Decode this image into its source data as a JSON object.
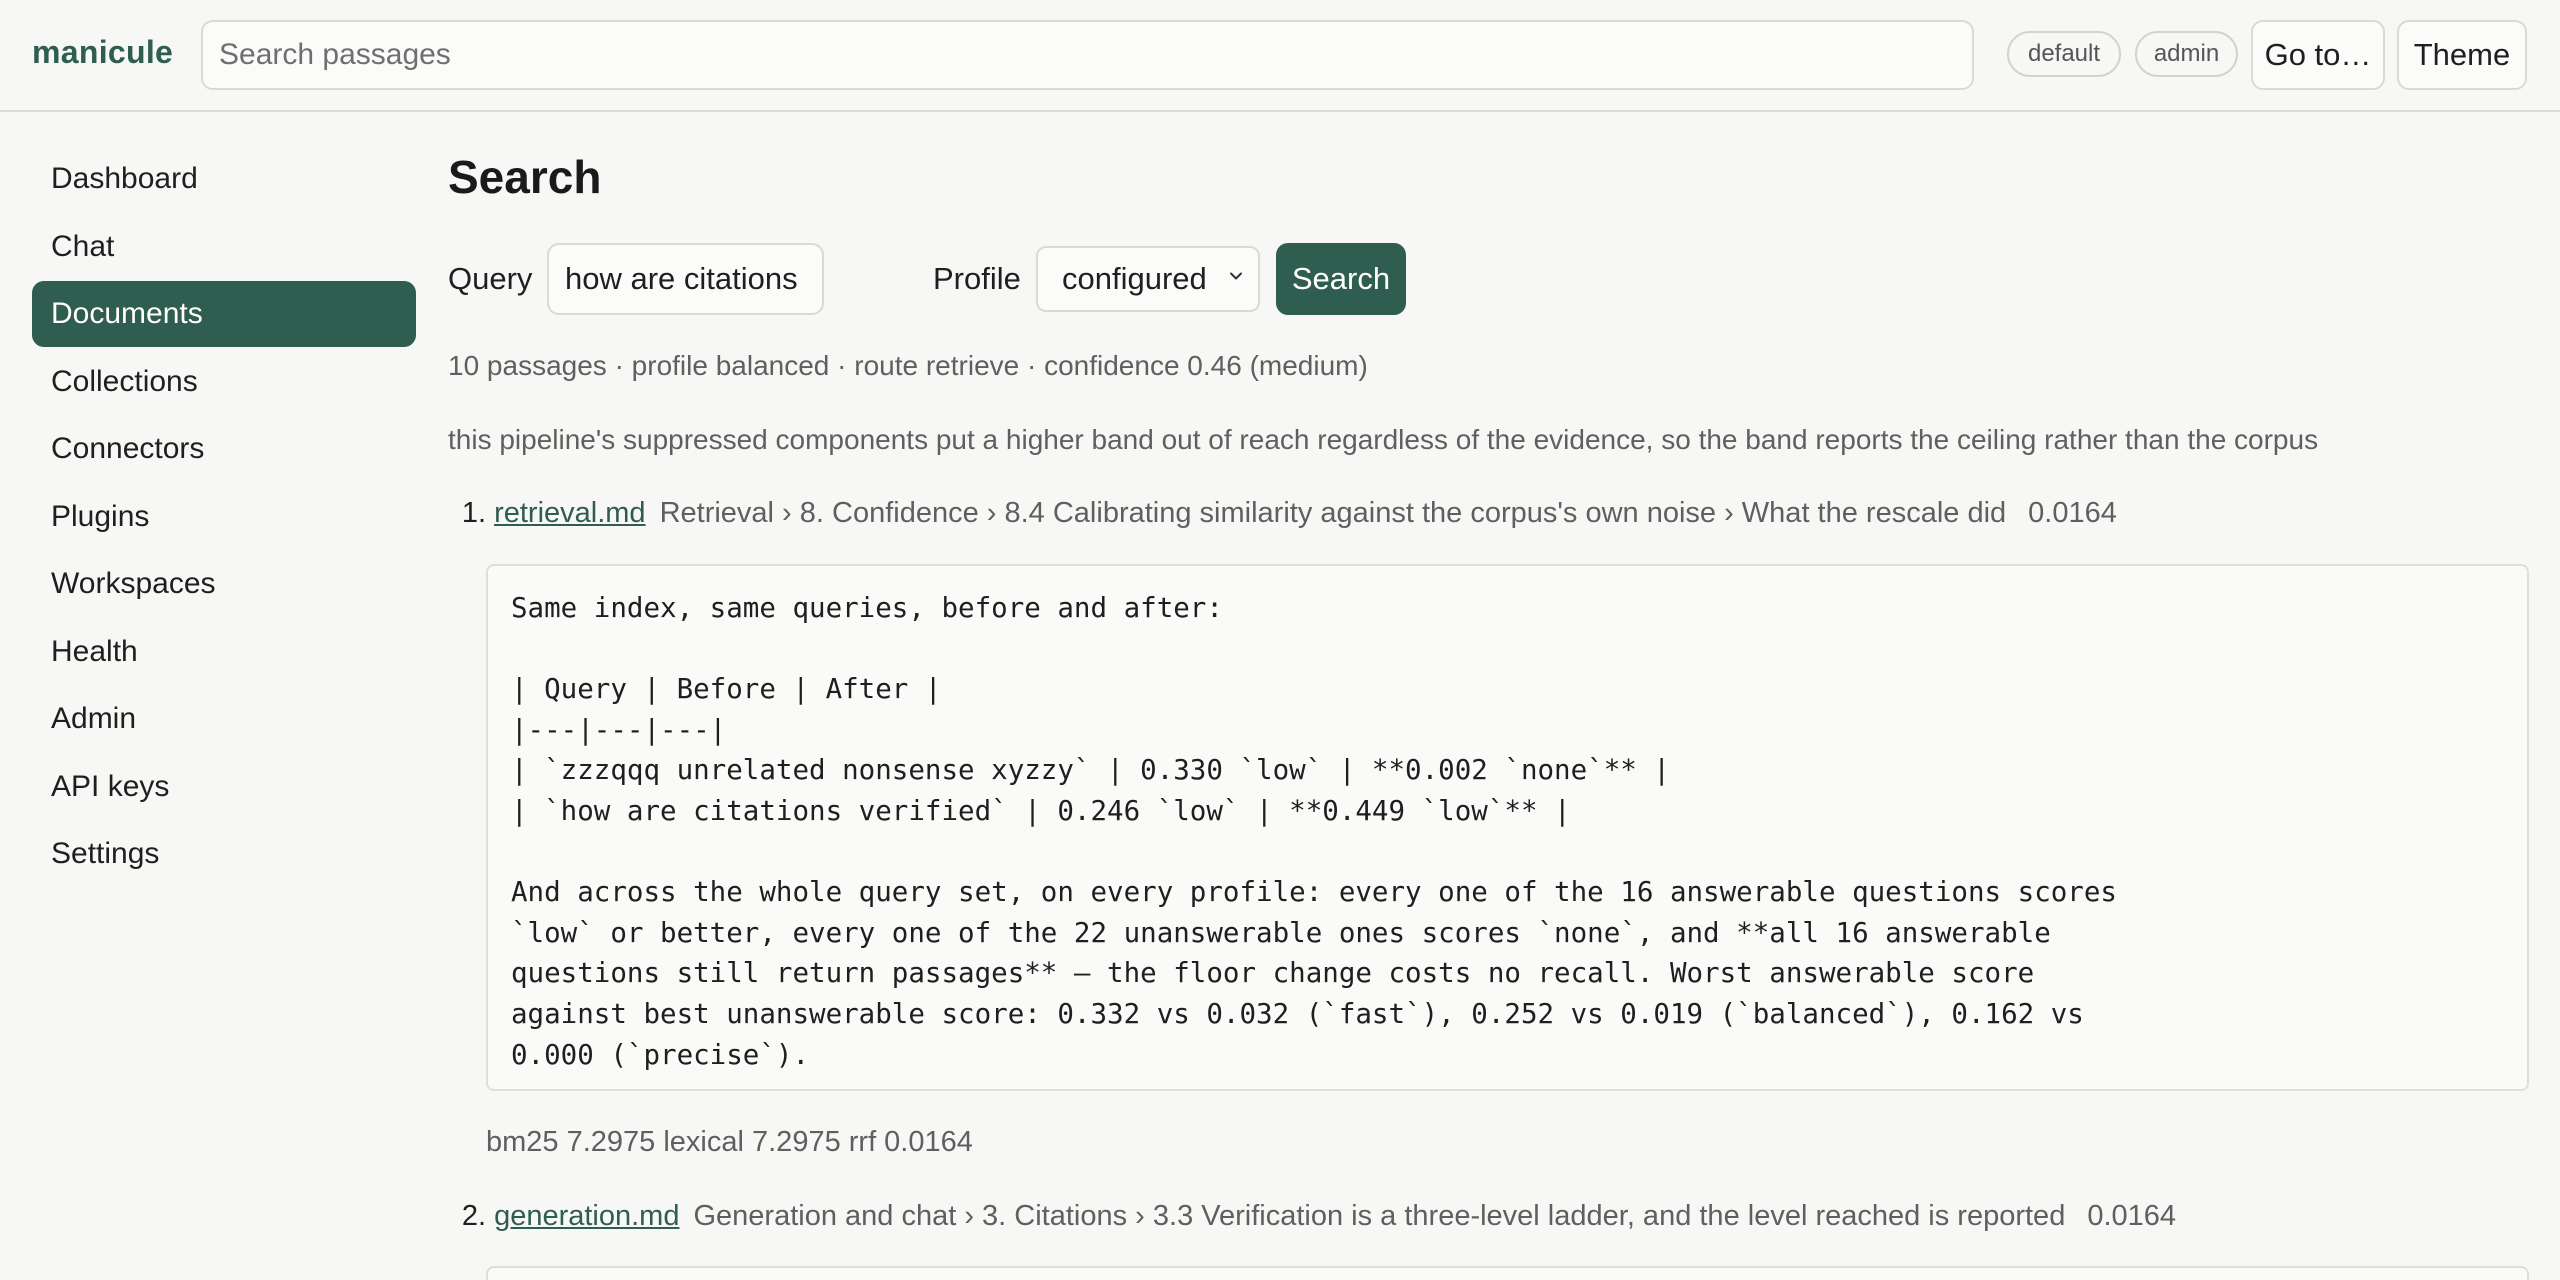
{
  "app": {
    "brand": "manicule"
  },
  "topbar": {
    "search_placeholder": "Search passages",
    "badges": [
      "default",
      "admin"
    ],
    "goto_label": "Go to…",
    "theme_label": "Theme"
  },
  "sidebar": {
    "items": [
      {
        "label": "Dashboard",
        "active": false
      },
      {
        "label": "Chat",
        "active": false
      },
      {
        "label": "Documents",
        "active": true
      },
      {
        "label": "Collections",
        "active": false
      },
      {
        "label": "Connectors",
        "active": false
      },
      {
        "label": "Plugins",
        "active": false
      },
      {
        "label": "Workspaces",
        "active": false
      },
      {
        "label": "Health",
        "active": false
      },
      {
        "label": "Admin",
        "active": false
      },
      {
        "label": "API keys",
        "active": false
      },
      {
        "label": "Settings",
        "active": false
      }
    ]
  },
  "main": {
    "title": "Search",
    "form": {
      "query_label": "Query",
      "query_value": "how are citations verified",
      "profile_label": "Profile",
      "profile_value": "configured",
      "search_label": "Search"
    },
    "summary": "10 passages · profile balanced · route retrieve · confidence 0.46 (medium)",
    "note": "this pipeline's suppressed components put a higher band out of reach regardless of the evidence, so the band reports the ceiling rather than the corpus",
    "results": [
      {
        "number": "1.",
        "file": "retrieval.md",
        "breadcrumb": "Retrieval › 8. Confidence › 8.4 Calibrating similarity against the corpus's own noise › What the rescale did",
        "score": "0.0164",
        "passage": "Same index, same queries, before and after:\n\n| Query | Before | After |\n|---|---|---|\n| `zzzqqq unrelated nonsense xyzzy` | 0.330 `low` | **0.002 `none`** |\n| `how are citations verified` | 0.246 `low` | **0.449 `low`** |\n\nAnd across the whole query set, on every profile: every one of the 16 answerable questions scores\n`low` or better, every one of the 22 unanswerable ones scores `none`, and **all 16 answerable\nquestions still return passages** — the floor change costs no recall. Worst answerable score\nagainst best unanswerable score: 0.332 vs 0.032 (`fast`), 0.252 vs 0.019 (`balanced`), 0.162 vs\n0.000 (`precise`).",
        "scores": "bm25 7.2975 lexical 7.2975 rrf 0.0164"
      },
      {
        "number": "2.",
        "file": "generation.md",
        "breadcrumb": "Generation and chat › 3. Citations › 3.3 Verification is a three-level ladder, and the level reached is reported",
        "score": "0.0164",
        "passage": "",
        "scores": ""
      }
    ]
  }
}
